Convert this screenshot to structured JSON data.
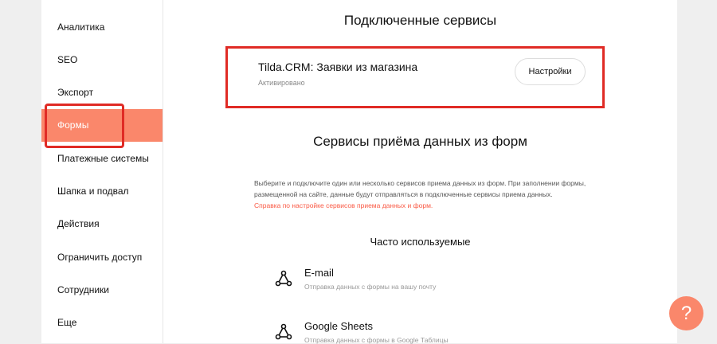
{
  "sidebar": {
    "items": [
      {
        "label": "Аналитика"
      },
      {
        "label": "SEO"
      },
      {
        "label": "Экспорт"
      },
      {
        "label": "Формы",
        "active": true
      },
      {
        "label": "Платежные системы"
      },
      {
        "label": "Шапка и подвал"
      },
      {
        "label": "Действия"
      },
      {
        "label": "Ограничить доступ"
      },
      {
        "label": "Сотрудники"
      },
      {
        "label": "Еще"
      }
    ]
  },
  "connected": {
    "heading": "Подключенные сервисы",
    "service": {
      "title": "Tilda.CRM: Заявки из магазина",
      "status": "Активировано",
      "button_label": "Настройки"
    }
  },
  "receivers": {
    "heading": "Сервисы приёма данных из форм",
    "description": "Выберите и подключите один или несколько сервисов приема данных из форм. При заполнении формы, размещенной на сайте, данные будут отправляться в подключенные сервисы приема данных.",
    "help_link": "Справка по настройке сервисов приема данных и форм.",
    "popular_heading": "Часто используемые",
    "services": [
      {
        "title": "E-mail",
        "desc": "Отправка данных с формы на вашу почту",
        "icon": "share-icon"
      },
      {
        "title": "Google Sheets",
        "desc": "Отправка данных с формы в Google Таблицы",
        "icon": "share-icon"
      }
    ]
  },
  "help_button": {
    "symbol": "?",
    "icon": "question-icon"
  },
  "colors": {
    "accent": "#fa876b",
    "highlight": "#e02b25",
    "link": "#fa5a45"
  }
}
